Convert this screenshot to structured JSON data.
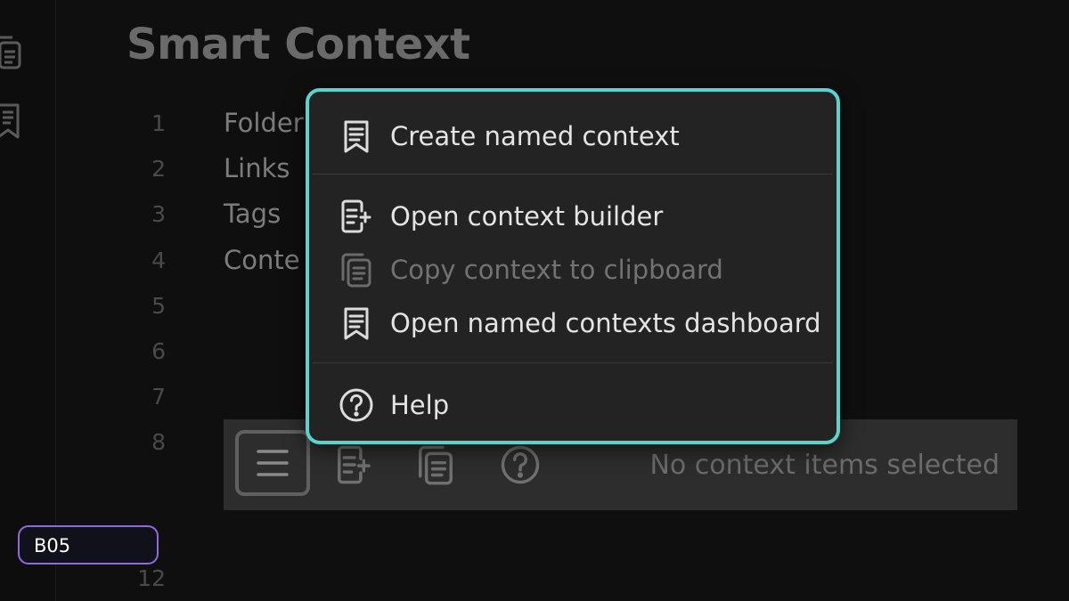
{
  "editor": {
    "title": "Smart Context",
    "lines": [
      {
        "no": "1",
        "text": "Folder"
      },
      {
        "no": "2",
        "text": "Links"
      },
      {
        "no": "3",
        "text": "Tags"
      },
      {
        "no": "4",
        "text": "Conte"
      },
      {
        "no": "5",
        "text": ""
      },
      {
        "no": "6",
        "text": ""
      },
      {
        "no": "7",
        "text": ""
      },
      {
        "no": "8",
        "text": ""
      },
      {
        "no": "12",
        "text": ""
      }
    ]
  },
  "menu": {
    "items": [
      {
        "label": "Create named context",
        "icon": "bookmark-doc-icon",
        "enabled": true
      },
      {
        "label": "Open context builder",
        "icon": "doc-plus-icon",
        "enabled": true
      },
      {
        "label": "Copy context to clipboard",
        "icon": "copy-icon",
        "enabled": false
      },
      {
        "label": "Open named contexts dashboard",
        "icon": "bookmark-doc-icon",
        "enabled": true
      },
      {
        "label": "Help",
        "icon": "help-circle-icon",
        "enabled": true
      }
    ],
    "accent_color": "#59d3cc"
  },
  "toolbar": {
    "status": "No context items selected"
  },
  "badge": {
    "label": "B05",
    "color": "#8a6ddb"
  }
}
